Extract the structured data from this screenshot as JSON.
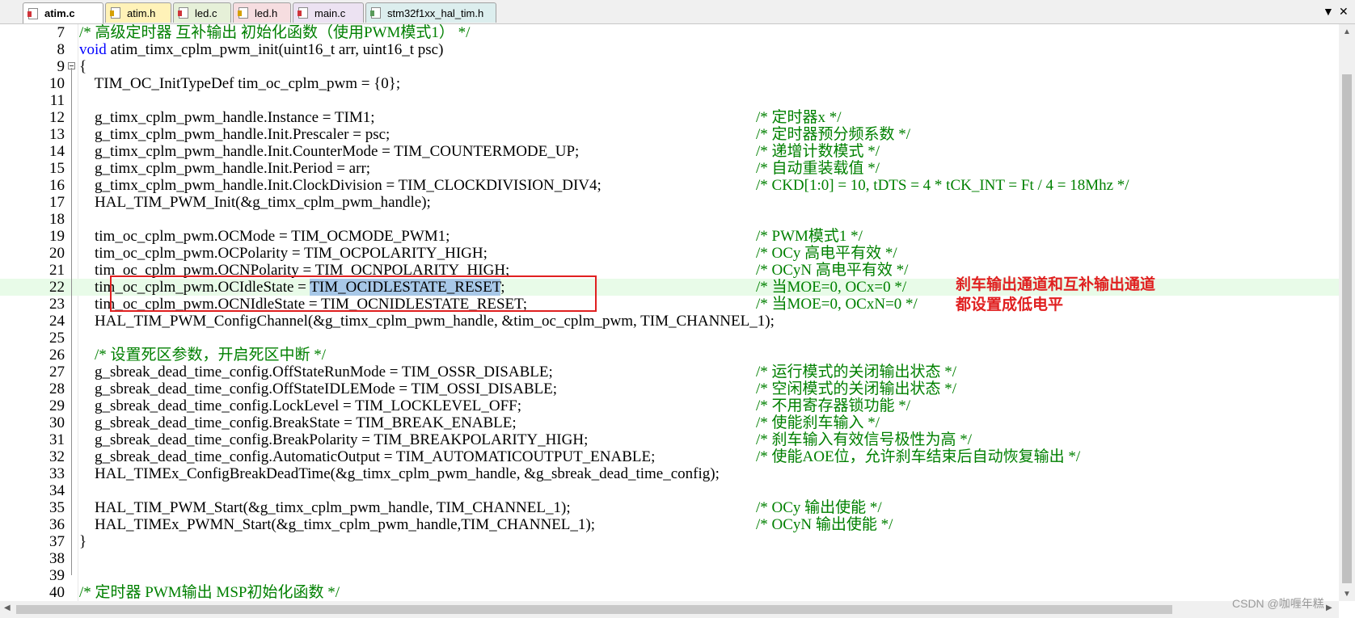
{
  "tabs": [
    {
      "label": "atim.c",
      "kind": "c",
      "active": true
    },
    {
      "label": "atim.h",
      "kind": "h",
      "active": false
    },
    {
      "label": "led.c",
      "kind": "c",
      "active": false
    },
    {
      "label": "led.h",
      "kind": "h",
      "active": false
    },
    {
      "label": "main.c",
      "kind": "c",
      "active": false
    },
    {
      "label": "stm32f1xx_hal_tim.h",
      "kind": "h2",
      "active": false
    }
  ],
  "tab_controls": {
    "dropdown": "▼",
    "close": "✕"
  },
  "editor": {
    "lines": [
      {
        "num": "7",
        "code": "/* 高级定时器 互补输出 初始化函数（使用PWM模式1） */",
        "type": "comment"
      },
      {
        "num": "8",
        "code": "void atim_timx_cplm_pwm_init(uint16_t arr, uint16_t psc)",
        "type": "keyword_start"
      },
      {
        "num": "9",
        "code": "{",
        "type": "plain",
        "fold": true
      },
      {
        "num": "10",
        "code": "    TIM_OC_InitTypeDef tim_oc_cplm_pwm = {0};",
        "type": "plain"
      },
      {
        "num": "11",
        "code": "",
        "type": "plain"
      },
      {
        "num": "12",
        "code": "    g_timx_cplm_pwm_handle.Instance = TIM1;",
        "comment": "/* 定时器x */",
        "type": "code_comment"
      },
      {
        "num": "13",
        "code": "    g_timx_cplm_pwm_handle.Init.Prescaler = psc;",
        "comment": "/* 定时器预分频系数 */",
        "type": "code_comment"
      },
      {
        "num": "14",
        "code": "    g_timx_cplm_pwm_handle.Init.CounterMode = TIM_COUNTERMODE_UP;",
        "comment": "/* 递增计数模式 */",
        "type": "code_comment"
      },
      {
        "num": "15",
        "code": "    g_timx_cplm_pwm_handle.Init.Period = arr;",
        "comment": "/* 自动重装载值 */",
        "type": "code_comment"
      },
      {
        "num": "16",
        "code": "    g_timx_cplm_pwm_handle.Init.ClockDivision = TIM_CLOCKDIVISION_DIV4;",
        "comment": "/* CKD[1:0] = 10, tDTS = 4 * tCK_INT = Ft / 4 = 18Mhz */",
        "type": "code_comment"
      },
      {
        "num": "17",
        "code": "    HAL_TIM_PWM_Init(&g_timx_cplm_pwm_handle);",
        "type": "plain"
      },
      {
        "num": "18",
        "code": "",
        "type": "plain"
      },
      {
        "num": "19",
        "code": "    tim_oc_cplm_pwm.OCMode = TIM_OCMODE_PWM1;",
        "comment": "/* PWM模式1 */",
        "type": "code_comment"
      },
      {
        "num": "20",
        "code": "    tim_oc_cplm_pwm.OCPolarity = TIM_OCPOLARITY_HIGH;",
        "comment": "/* OCy 高电平有效 */",
        "type": "code_comment"
      },
      {
        "num": "21",
        "code": "    tim_oc_cplm_pwm.OCNPolarity = TIM_OCNPOLARITY_HIGH;",
        "comment": "/* OCyN 高电平有效 */",
        "type": "code_comment"
      },
      {
        "num": "22",
        "code_pre": "    tim_oc_cplm_pwm.OCIdleState = ",
        "code_sel": "TIM_OCIDLESTATE_RESET",
        "code_post": ";",
        "comment": "/* 当MOE=0, OCx=0 */",
        "type": "selected",
        "highlight": true
      },
      {
        "num": "23",
        "code": "    tim_oc_cplm_pwm.OCNIdleState = TIM_OCNIDLESTATE_RESET;",
        "comment": "/* 当MOE=0, OCxN=0 */",
        "type": "code_comment"
      },
      {
        "num": "24",
        "code": "    HAL_TIM_PWM_ConfigChannel(&g_timx_cplm_pwm_handle, &tim_oc_cplm_pwm, TIM_CHANNEL_1);",
        "type": "plain"
      },
      {
        "num": "25",
        "code": "",
        "type": "plain"
      },
      {
        "num": "26",
        "code": "    /* 设置死区参数，开启死区中断 */",
        "type": "comment"
      },
      {
        "num": "27",
        "code": "    g_sbreak_dead_time_config.OffStateRunMode = TIM_OSSR_DISABLE;",
        "comment": "/* 运行模式的关闭输出状态 */",
        "type": "code_comment"
      },
      {
        "num": "28",
        "code": "    g_sbreak_dead_time_config.OffStateIDLEMode = TIM_OSSI_DISABLE;",
        "comment": "/* 空闲模式的关闭输出状态 */",
        "type": "code_comment"
      },
      {
        "num": "29",
        "code": "    g_sbreak_dead_time_config.LockLevel = TIM_LOCKLEVEL_OFF;",
        "comment": "/* 不用寄存器锁功能 */",
        "type": "code_comment"
      },
      {
        "num": "30",
        "code": "    g_sbreak_dead_time_config.BreakState = TIM_BREAK_ENABLE;",
        "comment": "/* 使能刹车输入 */",
        "type": "code_comment"
      },
      {
        "num": "31",
        "code": "    g_sbreak_dead_time_config.BreakPolarity = TIM_BREAKPOLARITY_HIGH;",
        "comment": "/* 刹车输入有效信号极性为高 */",
        "type": "code_comment"
      },
      {
        "num": "32",
        "code": "    g_sbreak_dead_time_config.AutomaticOutput = TIM_AUTOMATICOUTPUT_ENABLE;",
        "comment": "/* 使能AOE位，允许刹车结束后自动恢复输出 */",
        "type": "code_comment"
      },
      {
        "num": "33",
        "code": "    HAL_TIMEx_ConfigBreakDeadTime(&g_timx_cplm_pwm_handle, &g_sbreak_dead_time_config);",
        "type": "plain"
      },
      {
        "num": "34",
        "code": "",
        "type": "plain"
      },
      {
        "num": "35",
        "code": "    HAL_TIM_PWM_Start(&g_timx_cplm_pwm_handle, TIM_CHANNEL_1);",
        "comment": "/* OCy 输出使能 */",
        "type": "code_comment"
      },
      {
        "num": "36",
        "code": "    HAL_TIMEx_PWMN_Start(&g_timx_cplm_pwm_handle,TIM_CHANNEL_1);",
        "comment": "/* OCyN 输出使能 */",
        "type": "code_comment"
      },
      {
        "num": "37",
        "code": "}",
        "type": "plain"
      },
      {
        "num": "38",
        "code": "",
        "type": "plain"
      },
      {
        "num": "39",
        "code": "",
        "type": "plain"
      },
      {
        "num": "40",
        "code": "/* 定时器 PWM输出 MSP初始化函数 */",
        "type": "comment"
      }
    ]
  },
  "annotation": {
    "line1": "刹车输出通道和互补输出通道",
    "line2": "都设置成低电平",
    "color": "#e02020"
  },
  "colors": {
    "keyword": "#0000ff",
    "comment": "#008000",
    "current_line": "#e8fbe8",
    "selection": "#a8c8e8"
  },
  "watermark": "CSDN @咖喱年糕"
}
